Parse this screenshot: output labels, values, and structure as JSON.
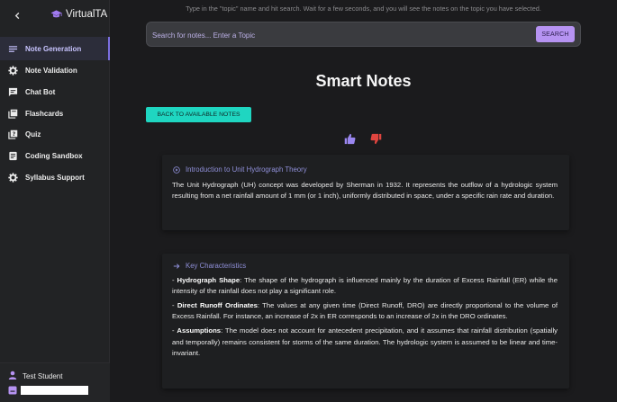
{
  "sidebar": {
    "brand": "VirtualTA",
    "items": [
      {
        "label": "Note Generation",
        "icon": "lines-icon"
      },
      {
        "label": "Note Validation",
        "icon": "gear-icon"
      },
      {
        "label": "Chat Bot",
        "icon": "chat-icon"
      },
      {
        "label": "Flashcards",
        "icon": "flashcards-icon"
      },
      {
        "label": "Quiz",
        "icon": "quiz-icon"
      },
      {
        "label": "Coding Sandbox",
        "icon": "document-icon"
      },
      {
        "label": "Syllabus Support",
        "icon": "gear-icon"
      }
    ],
    "user_name": "Test Student",
    "user_input_value": ""
  },
  "main": {
    "hint": "Type in the \"topic\" name and hit search. Wait for a few seconds, and you will see the notes on the topic you have selected.",
    "search": {
      "placeholder": "Search for notes... Enter a Topic",
      "button": "SEARCH"
    },
    "title": "Smart Notes",
    "back_button": "BACK TO AVAILABLE NOTES",
    "cards": [
      {
        "heading": "Introduction to Unit Hydrograph Theory",
        "body": "The Unit Hydrograph (UH) concept was developed by Sherman in 1932. It represents the outflow of a hydrologic system resulting from a net rainfall amount of 1 mm (or 1 inch), uniformly distributed in space, under a specific rain rate and duration."
      },
      {
        "heading": "Key Characteristics",
        "points": [
          {
            "term": "Hydrograph Shape",
            "text": ": The shape of the hydrograph is influenced mainly by the duration of Excess Rainfall (ER) while the intensity of the rainfall does not play a significant role."
          },
          {
            "term": "Direct Runoff Ordinates",
            "text": ": The values at any given time (Direct Runoff, DRO) are directly proportional to the volume of Excess Rainfall. For instance, an increase of 2x in ER corresponds to an increase of 2x in the DRO ordinates."
          },
          {
            "term": "Assumptions",
            "text": ": The model does not account for antecedent precipitation, and it assumes that rainfall distribution (spatially and temporally) remains consistent for storms of the same duration. The hydrologic system is assumed to be linear and time-invariant."
          }
        ]
      }
    ]
  },
  "colors": {
    "accent_purple": "#b693f2",
    "accent_teal": "#1fd6c1",
    "thumb_up": "#9a86f0",
    "thumb_down": "#e0453f"
  }
}
